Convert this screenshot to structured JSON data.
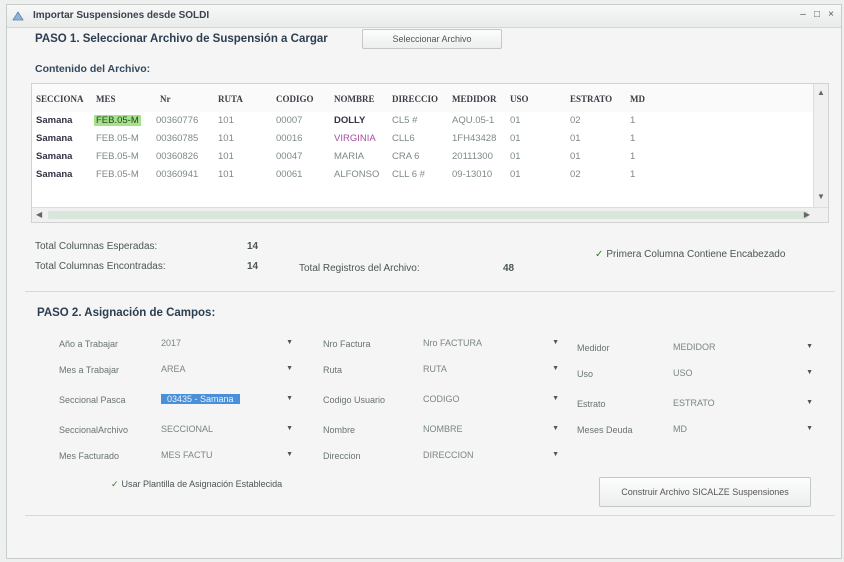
{
  "window": {
    "title": "Importar Suspensiones desde SOLDI"
  },
  "step1": {
    "title": "PASO 1. Seleccionar Archivo de Suspensión a Cargar",
    "select_button": "Seleccionar Archivo",
    "content_label": "Contenido del Archivo:"
  },
  "table": {
    "columns": [
      "SECCIONA",
      "MES",
      "Nr",
      "RUTA",
      "CODIGO",
      "NOMBRE",
      "DIRECCIO",
      "MEDIDOR",
      "USO",
      "ESTRATO",
      "MD"
    ],
    "rows": [
      [
        "Samana",
        "FEB.05-M",
        "00360776",
        "101",
        "00007",
        "DOLLY",
        "CL5 #",
        "AQU.05-1",
        "01",
        "02",
        "1"
      ],
      [
        "Samana",
        "FEB.05-M",
        "00360785",
        "101",
        "00016",
        "VIRGINIA",
        "CLL6",
        "1FH43428",
        "01",
        "01",
        "1"
      ],
      [
        "Samana",
        "FEB.05-M",
        "00360826",
        "101",
        "00047",
        "MARIA",
        "CRA 6",
        "20111300",
        "01",
        "01",
        "1"
      ],
      [
        "Samana",
        "FEB.05-M",
        "00360941",
        "101",
        "00061",
        "ALFONSO",
        "CLL 6 #",
        "09-13010",
        "01",
        "02",
        "1"
      ]
    ]
  },
  "totals": {
    "expected_label": "Total Columnas Esperadas:",
    "expected_value": "14",
    "found_label": "Total Columnas Encontradas:",
    "found_value": "14",
    "records_label": "Total Registros del Archivo:",
    "records_value": "48",
    "header_check_label": "Primera Columna Contiene Encabezado"
  },
  "step2": {
    "title": "PASO 2. Asignación de Campos:",
    "fields_col1": [
      {
        "label": "Año a Trabajar",
        "value": "2017"
      },
      {
        "label": "Mes a Trabajar",
        "value": "AREA"
      },
      {
        "label": "Seccional Pasca",
        "value": "03435 - Samana"
      },
      {
        "label": "SeccionalArchivo",
        "value": "SECCIONAL"
      },
      {
        "label": "Mes Facturado",
        "value": "MES FACTU"
      }
    ],
    "fields_col2": [
      {
        "label": "Nro Factura",
        "value": "Nro FACTURA"
      },
      {
        "label": "Ruta",
        "value": "RUTA"
      },
      {
        "label": "Codigo Usuario",
        "value": "CODIGO"
      },
      {
        "label": "Nombre",
        "value": "NOMBRE"
      },
      {
        "label": "Direccion",
        "value": "DIRECCION"
      }
    ],
    "fields_col3": [
      {
        "label": "Medidor",
        "value": "MEDIDOR"
      },
      {
        "label": "Uso",
        "value": "USO"
      },
      {
        "label": "Estrato",
        "value": "ESTRATO"
      },
      {
        "label": "Meses Deuda",
        "value": "MD"
      }
    ],
    "template_check_label": "Usar Plantilla de Asignación Establecida",
    "build_button": "Construir Archivo SICALZE Suspensiones"
  }
}
